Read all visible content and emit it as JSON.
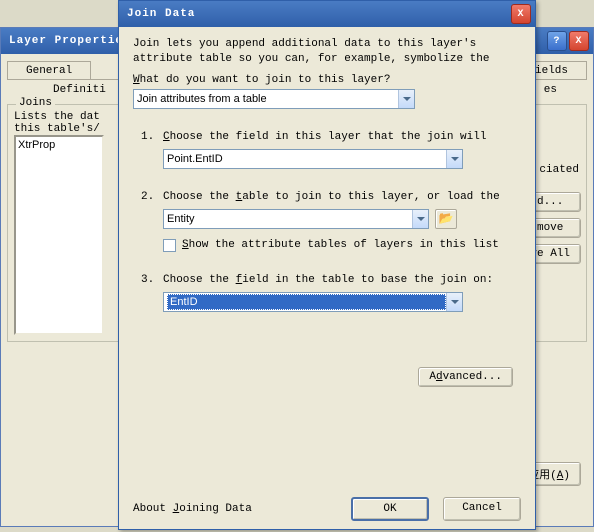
{
  "back": {
    "title": "Layer Properties",
    "help_icon": "?",
    "close_icon": "X",
    "tabs": {
      "general": "General",
      "fields": "Fields"
    },
    "subtabs": {
      "left": "Definiti",
      "right": "es"
    },
    "joins": {
      "legend": "Joins",
      "list_intro_line1": "Lists the dat",
      "list_intro_line2": "this table's/",
      "assoc_label_frag": "ciated",
      "list_items": [
        "XtrProp"
      ]
    },
    "buttons": {
      "add": "d...",
      "remove": "move",
      "remove_all": "ve All"
    },
    "apply": "应用(A)"
  },
  "front": {
    "title": "Join Data",
    "close_icon": "X",
    "intro_l1": "Join lets you append additional data to this layer's",
    "intro_l2": "attribute table so you can, for example, symbolize the",
    "prompt": "What do you want to join to this layer?",
    "main_dropdown": "Join attributes from a table",
    "step1": {
      "num": "1.",
      "text": "Choose the field in this layer that the join will",
      "value": "Point.EntID"
    },
    "step2": {
      "num": "2.",
      "text": "Choose the table to join to this layer, or load the",
      "value": "Entity",
      "checkbox_label": "Show the attribute tables of layers in this list"
    },
    "step3": {
      "num": "3.",
      "text": "Choose the field in the table to base the join on:",
      "value": "EntID"
    },
    "advanced": "Advanced...",
    "about_link": "About Joining Data",
    "ok": "OK",
    "cancel": "Cancel"
  }
}
